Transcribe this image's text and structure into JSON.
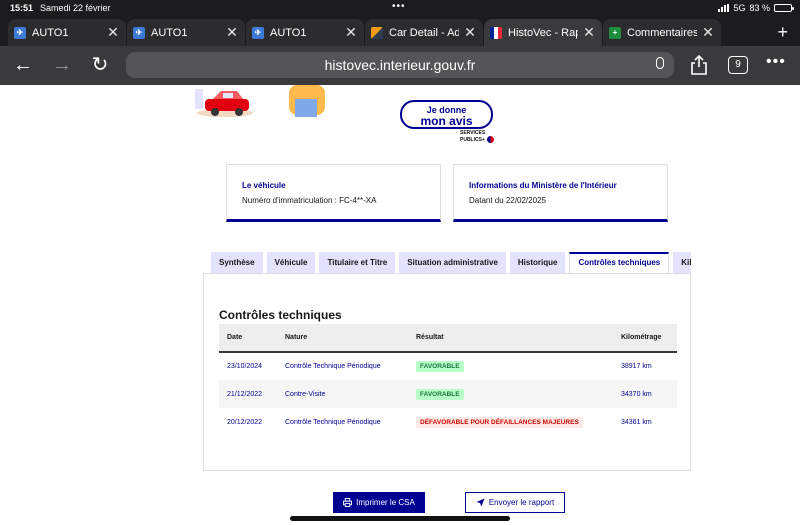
{
  "status_bar": {
    "time": "15:51",
    "date": "Samedi 22 février",
    "network": "5G",
    "battery": "83 %",
    "battery_level": 0.83
  },
  "browser": {
    "tabs": [
      {
        "label": "AUTO1",
        "icon": "auto1-favicon",
        "active": false
      },
      {
        "label": "AUTO1",
        "icon": "auto1-favicon",
        "active": false
      },
      {
        "label": "AUTO1",
        "icon": "auto1-favicon",
        "active": false
      },
      {
        "label": "Car Detail - Adm",
        "icon": "car-detail-favicon",
        "active": false
      },
      {
        "label": "HistoVec - Rapp",
        "icon": "histovec-favicon",
        "active": true
      },
      {
        "label": "Commentaires ce",
        "icon": "sheets-favicon",
        "active": false
      }
    ],
    "url": "histovec.interieur.gouv.fr",
    "tab_count": "9"
  },
  "feedback": {
    "line1": "Je donne",
    "line2": "mon avis",
    "sub1": "SERVICES",
    "sub2": "PUBLICS+"
  },
  "cards": {
    "vehicle": {
      "title": "Le véhicule",
      "text": "Numéro d'immatriculation : FC-4**-XA"
    },
    "ministry": {
      "title": "Informations du Ministère de l'Intérieur",
      "text": "Datant du 22/02/2025"
    }
  },
  "page_tabs": [
    {
      "label": "Synthèse",
      "active": false
    },
    {
      "label": "Véhicule",
      "active": false
    },
    {
      "label": "Titulaire et Titre",
      "active": false
    },
    {
      "label": "Situation administrative",
      "active": false
    },
    {
      "label": "Historique",
      "active": false
    },
    {
      "label": "Contrôles techniques",
      "active": true
    },
    {
      "label": "Kilo",
      "active": false
    }
  ],
  "controls": {
    "heading": "Contrôles techniques",
    "columns": {
      "date": "Date",
      "nature": "Nature",
      "result": "Résultat",
      "mileage": "Kilométrage"
    },
    "rows": [
      {
        "date": "23/10/2024",
        "nature": "Contrôle Technique Périodique",
        "result": "FAVORABLE",
        "status": "ok",
        "mileage": "38917 km"
      },
      {
        "date": "21/12/2022",
        "nature": "Contre-Visite",
        "result": "FAVORABLE",
        "status": "ok",
        "mileage": "34370 km"
      },
      {
        "date": "20/12/2022",
        "nature": "Contrôle Technique Périodique",
        "result": "DÉFAVORABLE POUR DÉFAILLANCES MAJEURES",
        "status": "ko",
        "mileage": "34361 km"
      }
    ]
  },
  "actions": {
    "print": "Imprimer le CSA",
    "send": "Envoyer le rapport"
  }
}
